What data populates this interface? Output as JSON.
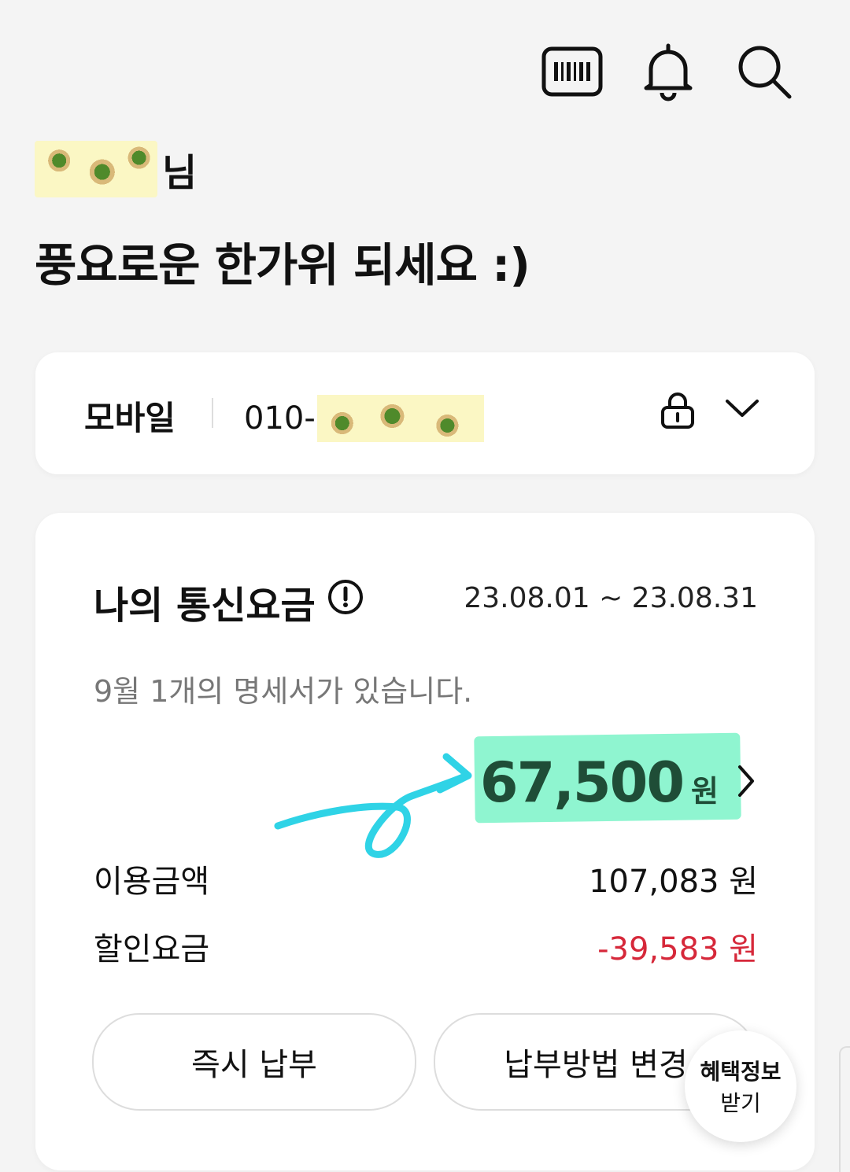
{
  "header": {
    "icons": [
      "barcode-icon",
      "bell-icon",
      "search-icon"
    ]
  },
  "greeting": {
    "name_suffix": "님",
    "message": "풍요로운 한가위 되세요 :)"
  },
  "line": {
    "type": "모바일",
    "number_prefix": "010-"
  },
  "fee": {
    "title": "나의 통신요금",
    "period": "23.08.01 ~ 23.08.31",
    "notice": "9월 1개의 명세서가 있습니다.",
    "total_value": "67,500",
    "total_unit": "원",
    "usage_label": "이용금액",
    "usage_value": "107,083 원",
    "discount_label": "할인요금",
    "discount_value": "-39,583 원",
    "pay_now_label": "즉시 납부",
    "change_method_label": "납부방법 변경"
  },
  "fab": {
    "line1": "혜택정보",
    "line2": "받기"
  },
  "colors": {
    "accent_green": "#1f4d37",
    "highlight": "#8ff5d0",
    "negative": "#d6283a",
    "doodle": "#2fd3e6"
  }
}
